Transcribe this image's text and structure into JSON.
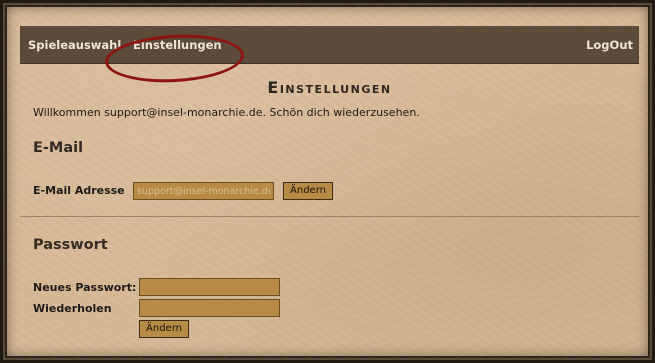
{
  "nav": {
    "games_label": "Spieleauswahl",
    "settings_label": "Einstellungen",
    "logout_label": "LogOut"
  },
  "page": {
    "title": "Einstellungen",
    "welcome": "Willkommen support@insel-monarchie.de. Schön dich wiederzusehen."
  },
  "email_section": {
    "heading": "E-Mail",
    "label": "E-Mail Adresse",
    "placeholder": "support@insel-monarchie.de",
    "button": "Ändern"
  },
  "password_section": {
    "heading": "Passwort",
    "new_label": "Neues Passwort:",
    "repeat_label": "Wiederholen",
    "new_value": "",
    "repeat_value": "",
    "button": "Ändern"
  },
  "colors": {
    "background": "#d7b896",
    "navbar": "#5c4a3a",
    "input": "#b78b45",
    "highlight": "#8e1410"
  }
}
